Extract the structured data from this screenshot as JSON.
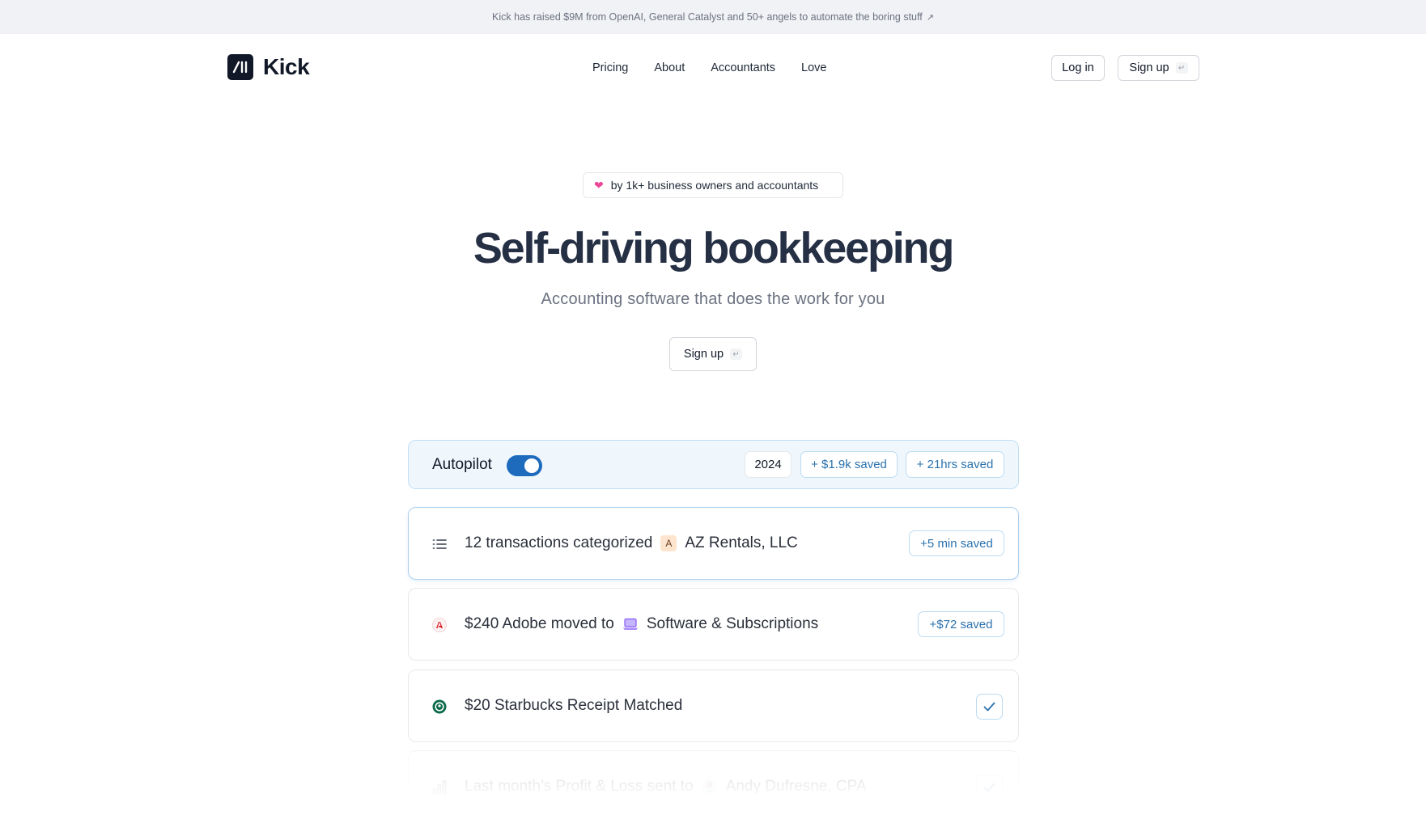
{
  "banner": {
    "text": "Kick has raised $9M from OpenAI, General Catalyst and 50+ angels to automate the boring stuff",
    "arrow": "↗"
  },
  "nav": {
    "logo_text": "Kick",
    "links": [
      "Pricing",
      "About",
      "Accountants",
      "Love"
    ],
    "login_label": "Log in",
    "signup_label": "Sign up"
  },
  "hero": {
    "pill_text": "by 1k+ business owners and accountants",
    "title": "Self-driving bookkeeping",
    "subtitle": "Accounting software that does the work for you",
    "signup_label": "Sign up"
  },
  "autopilot": {
    "label": "Autopilot",
    "enabled": true,
    "year": "2024",
    "money_saved": "+ $1.9k saved",
    "hours_saved": "+ 21hrs saved"
  },
  "feed": [
    {
      "icon": "list-icon",
      "text": "12 transactions categorized",
      "tag_letter": "A",
      "tag_text": "AZ Rentals, LLC",
      "badge": "+5 min saved"
    },
    {
      "icon": "adobe-icon",
      "text": "$240 Adobe moved to",
      "tag_text": "Software & Subscriptions",
      "badge": "+$72 saved"
    },
    {
      "icon": "starbucks-icon",
      "text": "$20 Starbucks Receipt Matched"
    },
    {
      "icon": "bar-chart-icon",
      "text": "Last month’s Profit & Loss sent to",
      "tag_text": "Andy Dufresne, CPA"
    }
  ],
  "colors": {
    "accent": "#1e6bbd",
    "badge_text": "#2a72ae",
    "autopilot_bg": "#eff7fd"
  }
}
